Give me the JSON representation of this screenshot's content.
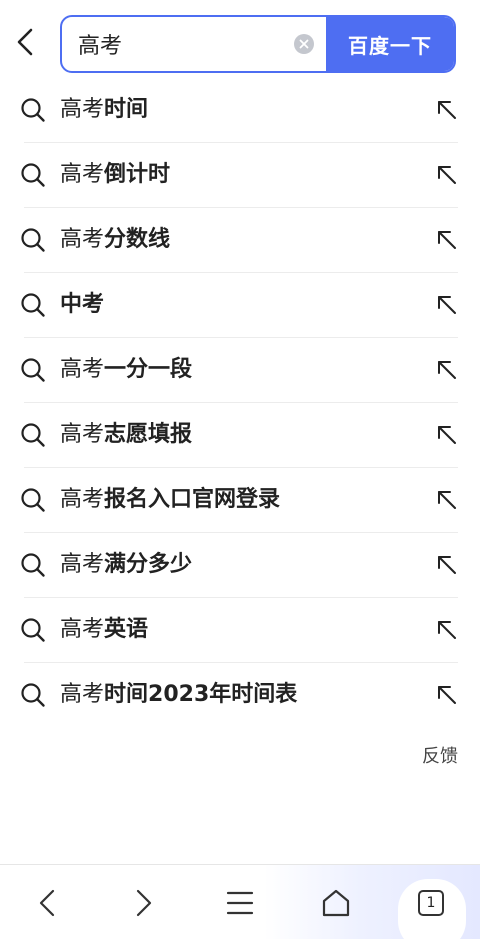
{
  "search": {
    "query": "高考",
    "submit_label": "百度一下"
  },
  "suggestions": [
    {
      "prefix": "高考",
      "suffix": "时间"
    },
    {
      "prefix": "高考",
      "suffix": "倒计时"
    },
    {
      "prefix": "高考",
      "suffix": "分数线"
    },
    {
      "prefix": "",
      "suffix": "中考"
    },
    {
      "prefix": "高考",
      "suffix": "一分一段"
    },
    {
      "prefix": "高考",
      "suffix": "志愿填报"
    },
    {
      "prefix": "高考",
      "suffix": "报名入口官网登录"
    },
    {
      "prefix": "高考",
      "suffix": "满分多少"
    },
    {
      "prefix": "高考",
      "suffix": "英语"
    },
    {
      "prefix": "高考",
      "suffix": "时间2023年时间表"
    }
  ],
  "feedback_label": "反馈",
  "bottom_nav": {
    "tab_count": "1"
  },
  "colors": {
    "accent": "#4e6ef2"
  }
}
